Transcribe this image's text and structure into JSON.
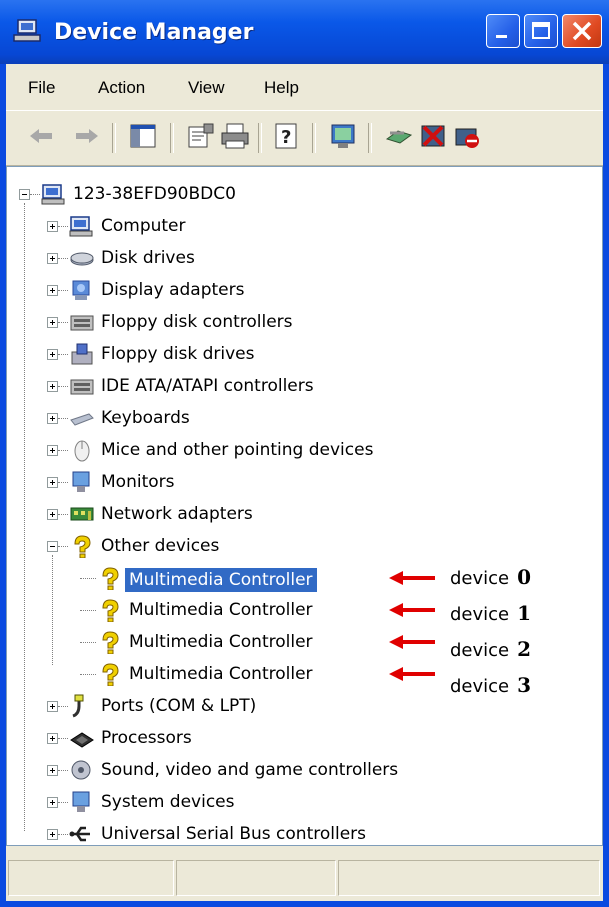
{
  "window": {
    "title": "Device Manager"
  },
  "menu": [
    "File",
    "Action",
    "View",
    "Help"
  ],
  "tree": {
    "root": "123-38EFD90BDC0",
    "categories": [
      "Computer",
      "Disk drives",
      "Display adapters",
      "Floppy disk controllers",
      "Floppy disk drives",
      "IDE ATA/ATAPI controllers",
      "Keyboards",
      "Mice and other pointing devices",
      "Monitors",
      "Network adapters",
      "Other devices"
    ],
    "other_devices_children": [
      "Multimedia Controller",
      "Multimedia Controller",
      "Multimedia Controller",
      "Multimedia Controller"
    ],
    "categories_after": [
      "Ports (COM & LPT)",
      "Processors",
      "Sound, video and game controllers",
      "System devices",
      "Universal Serial Bus controllers"
    ]
  },
  "annotations": [
    {
      "text": "device",
      "num": "0"
    },
    {
      "text": "device",
      "num": "1"
    },
    {
      "text": "device",
      "num": "2"
    },
    {
      "text": "device",
      "num": "3"
    }
  ],
  "colors": {
    "title_bar": "#0a58e8",
    "selection": "#316ac5",
    "arrow": "#e00000"
  }
}
